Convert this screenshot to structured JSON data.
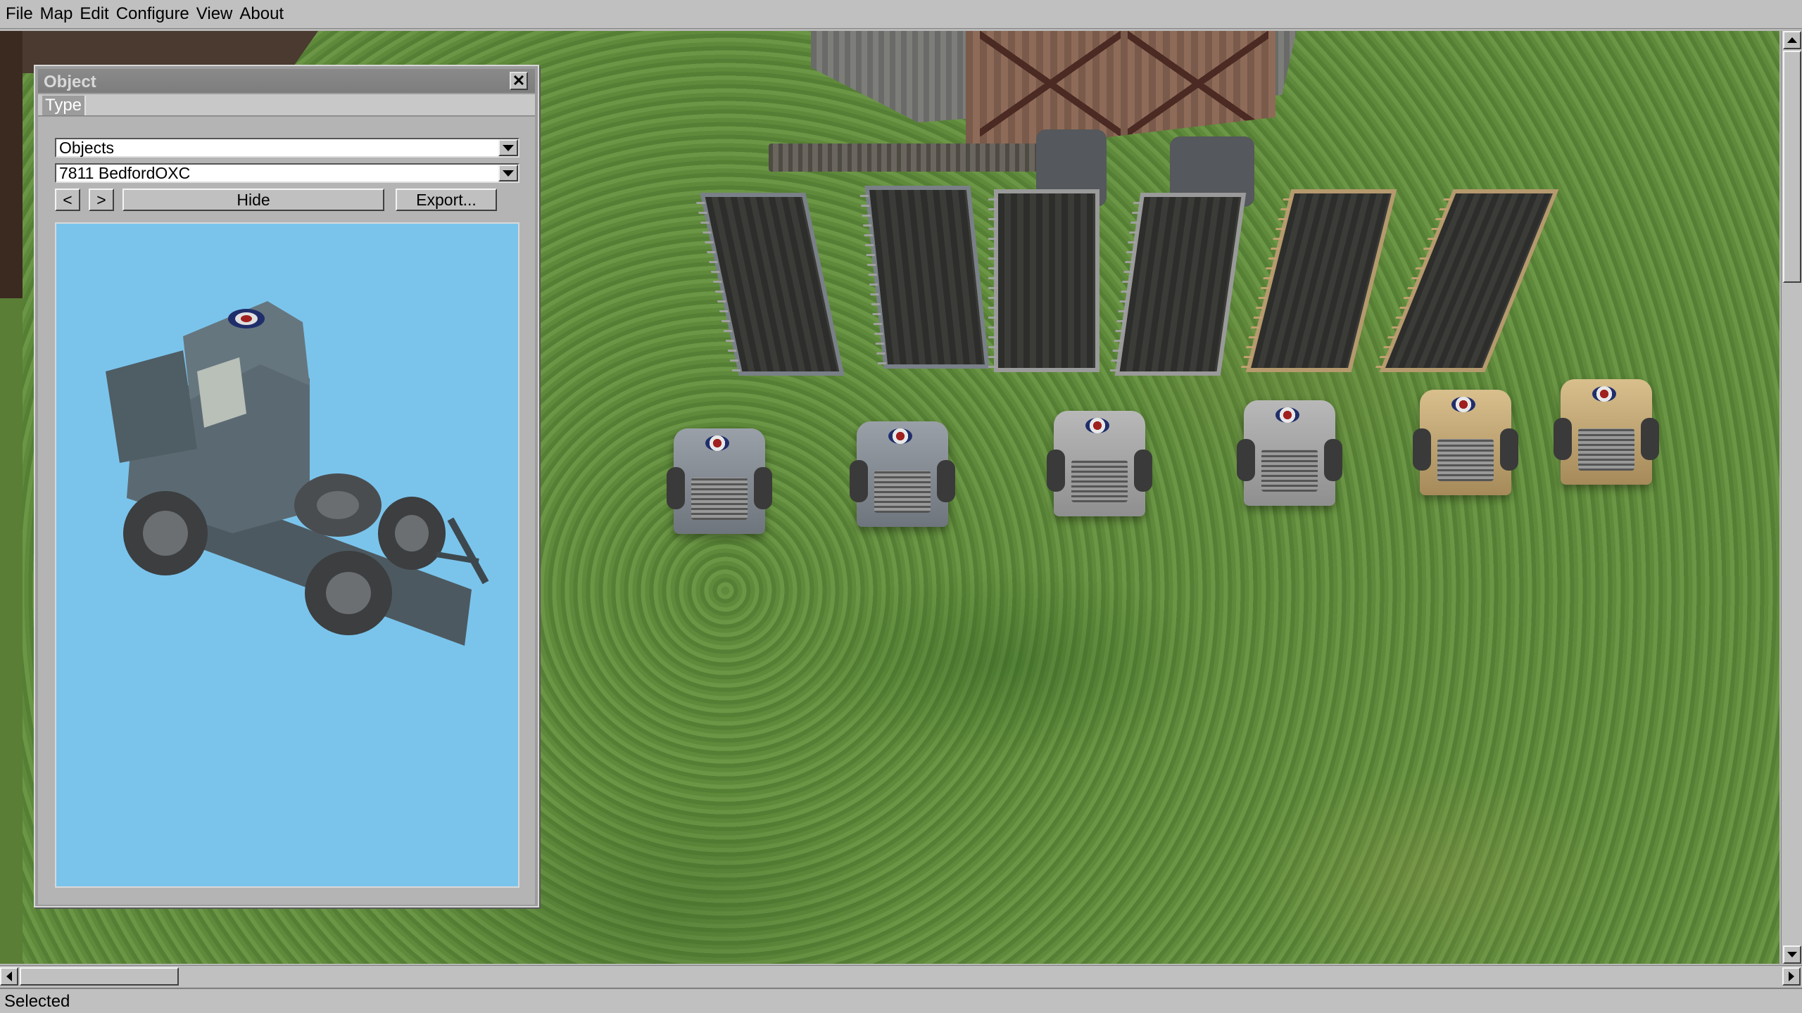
{
  "menu": {
    "items": [
      "File",
      "Map",
      "Edit",
      "Configure",
      "View",
      "About"
    ]
  },
  "object_window": {
    "title": "Object",
    "close_glyph": "✕",
    "tabs": [
      {
        "label": "Type"
      }
    ],
    "category_combo": {
      "value": "Objects"
    },
    "object_combo": {
      "value": "7811 BedfordOXC"
    },
    "buttons": {
      "prev": "<",
      "next": ">",
      "hide": "Hide",
      "export": "Export..."
    },
    "preview_background": "#7ac4ec"
  },
  "status": {
    "text": "Selected"
  },
  "colors": {
    "chrome": "#c0c0c0",
    "titlebar": "#7d7d7d",
    "grass": "#5f8a3b",
    "preview_sky": "#7ac4ec"
  },
  "icons": [
    "close-icon",
    "dropdown-arrow-icon",
    "scroll-up-icon",
    "scroll-down-icon",
    "scroll-left-icon",
    "scroll-right-icon"
  ]
}
